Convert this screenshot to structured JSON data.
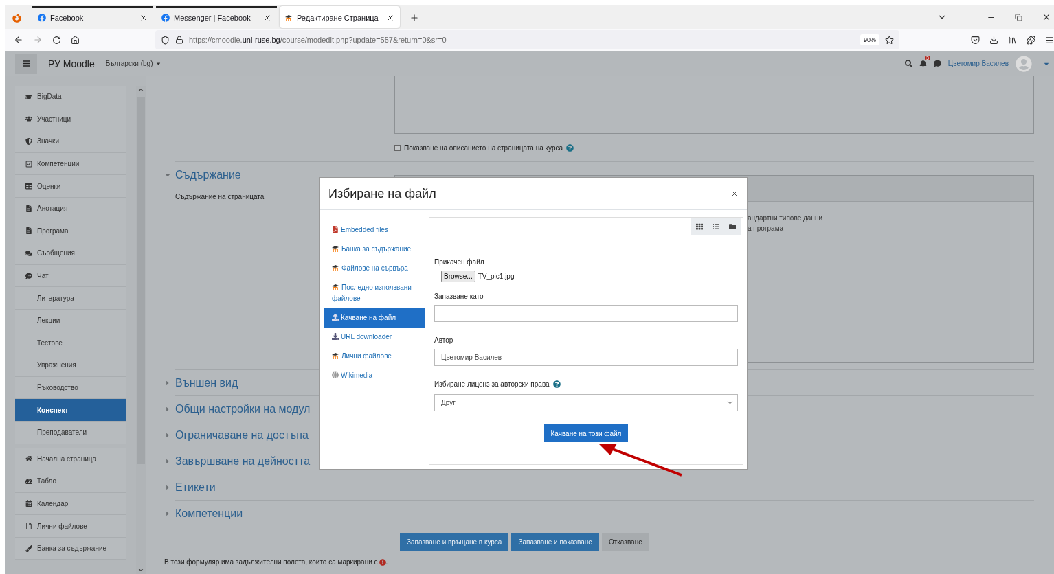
{
  "browser": {
    "tabs": [
      {
        "title": "Facebook",
        "selected": false
      },
      {
        "title": "Messenger | Facebook",
        "selected": false
      },
      {
        "title": "Редактиране Страница",
        "selected": true
      }
    ],
    "url": {
      "prefix": "https://cmoodle.",
      "host": "uni-ruse.bg",
      "path": "/course/modedit.php?update=557&return=0&sr=0"
    },
    "zoom": "90%"
  },
  "navbar": {
    "brand": "РУ Moodle",
    "language": "Български (bg)",
    "notification_count": "3",
    "user_name": "Цветомир Василев"
  },
  "sidebar": {
    "groups": [
      {
        "items": [
          {
            "label": "BigData",
            "selected": false
          },
          {
            "label": "Участници",
            "selected": false
          },
          {
            "label": "Значки",
            "selected": false
          },
          {
            "label": "Компетенции",
            "selected": false
          },
          {
            "label": "Оценки",
            "selected": false
          },
          {
            "label": "Анотация",
            "selected": false
          },
          {
            "label": "Програма",
            "selected": false
          },
          {
            "label": "Съобщения",
            "selected": false
          },
          {
            "label": "Чат",
            "selected": false
          },
          {
            "label": "Литература",
            "selected": false
          },
          {
            "label": "Лекции",
            "selected": false
          },
          {
            "label": "Тестове",
            "selected": false
          },
          {
            "label": "Упражнения",
            "selected": false
          },
          {
            "label": "Ръководство",
            "selected": false
          },
          {
            "label": "Конспект",
            "selected": true
          },
          {
            "label": "Преподаватели",
            "selected": false
          }
        ]
      },
      {
        "items": [
          {
            "label": "Начална страница",
            "selected": false
          },
          {
            "label": "Табло",
            "selected": false
          },
          {
            "label": "Календар",
            "selected": false
          },
          {
            "label": "Лични файлове",
            "selected": false
          },
          {
            "label": "Банка за съдържание",
            "selected": false
          }
        ]
      }
    ]
  },
  "main": {
    "description_checkbox": {
      "label": "Показване на описанието на страницата на курса",
      "checked": false
    },
    "sections": [
      {
        "title": "Съдържание",
        "expanded": true,
        "content_label": "Съдържание на страницата",
        "editor_lines": [
          "андартни типове данни",
          "а програма"
        ]
      },
      {
        "title": "Външен вид",
        "expanded": false
      },
      {
        "title": "Общи настройки на модул",
        "expanded": false
      },
      {
        "title": "Ограничаване на достъпа",
        "expanded": false
      },
      {
        "title": "Завършване на дейността",
        "expanded": false
      },
      {
        "title": "Етикети",
        "expanded": false
      },
      {
        "title": "Компетенции",
        "expanded": false
      }
    ],
    "buttons": [
      {
        "label": "Запазване и връщане в курса",
        "kind": "primary"
      },
      {
        "label": "Запазване и показване",
        "kind": "primary"
      },
      {
        "label": "Отказване",
        "kind": "secondary"
      }
    ],
    "required_note": "В този формуляр има задължителни полета, които са маркирани с",
    "required_note_end": " ."
  },
  "modal": {
    "title": "Избиране на файл",
    "repositories": [
      {
        "label": "Embedded files",
        "selected": false
      },
      {
        "label": "Банка за съдържание",
        "selected": false
      },
      {
        "label": "Файлове на сървъра",
        "selected": false
      },
      {
        "label": "Последно използвани файлове",
        "selected": false
      },
      {
        "label": "Качване на файл",
        "selected": true
      },
      {
        "label": "URL downloader",
        "selected": false
      },
      {
        "label": "Лични файлове",
        "selected": false
      },
      {
        "label": "Wikimedia",
        "selected": false
      }
    ],
    "attachment_label": "Прикачен файл",
    "browse_button": "Browse...",
    "file_name": "TV_pic1.jpg",
    "save_as_label": "Запазване като",
    "author_label": "Автор",
    "author_value": "Цветомир Василев",
    "license_label": "Избиране лиценз за авторски права",
    "license_value": "Друг",
    "upload_button": "Качване на този файл"
  }
}
